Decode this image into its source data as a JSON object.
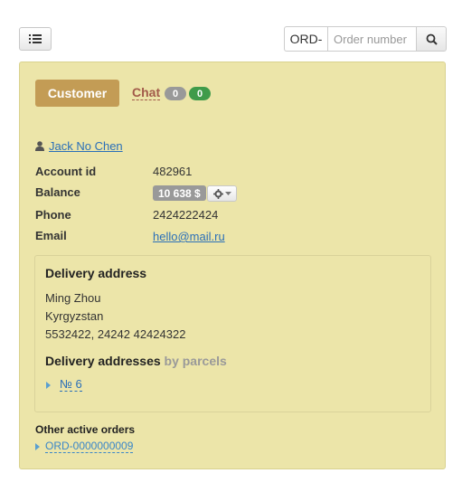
{
  "toolbar": {
    "menu_icon": "list-icon",
    "search_prefix": "ORD-",
    "search_placeholder": "Order number",
    "search_icon": "search-icon"
  },
  "tabs": {
    "customer_label": "Customer",
    "chat_label": "Chat",
    "chat_badge_1": "0",
    "chat_badge_2": "0"
  },
  "customer": {
    "icon": "user-icon",
    "name": "Jack No Chen",
    "account_id_label": "Account id",
    "account_id": "482961",
    "balance_label": "Balance",
    "balance": "10 638 $",
    "phone_label": "Phone",
    "phone": "2424222424",
    "email_label": "Email",
    "email": "hello@mail.ru"
  },
  "delivery": {
    "title": "Delivery address",
    "name": "Ming Zhou",
    "country": "Kyrgyzstan",
    "details": "5532422, 24242 42424322",
    "parcels_title": "Delivery addresses",
    "parcels_subtitle": "by parcels",
    "parcels": [
      "№ 6"
    ]
  },
  "other_orders": {
    "title": "Other active orders",
    "orders": [
      "ORD-0000000009"
    ]
  },
  "colors": {
    "panel_bg": "#ece5a9",
    "customer_tab": "#c39c55",
    "chat_label": "#a25a4a",
    "badge_green": "#3f9b4a",
    "link": "#2a6fb8"
  }
}
